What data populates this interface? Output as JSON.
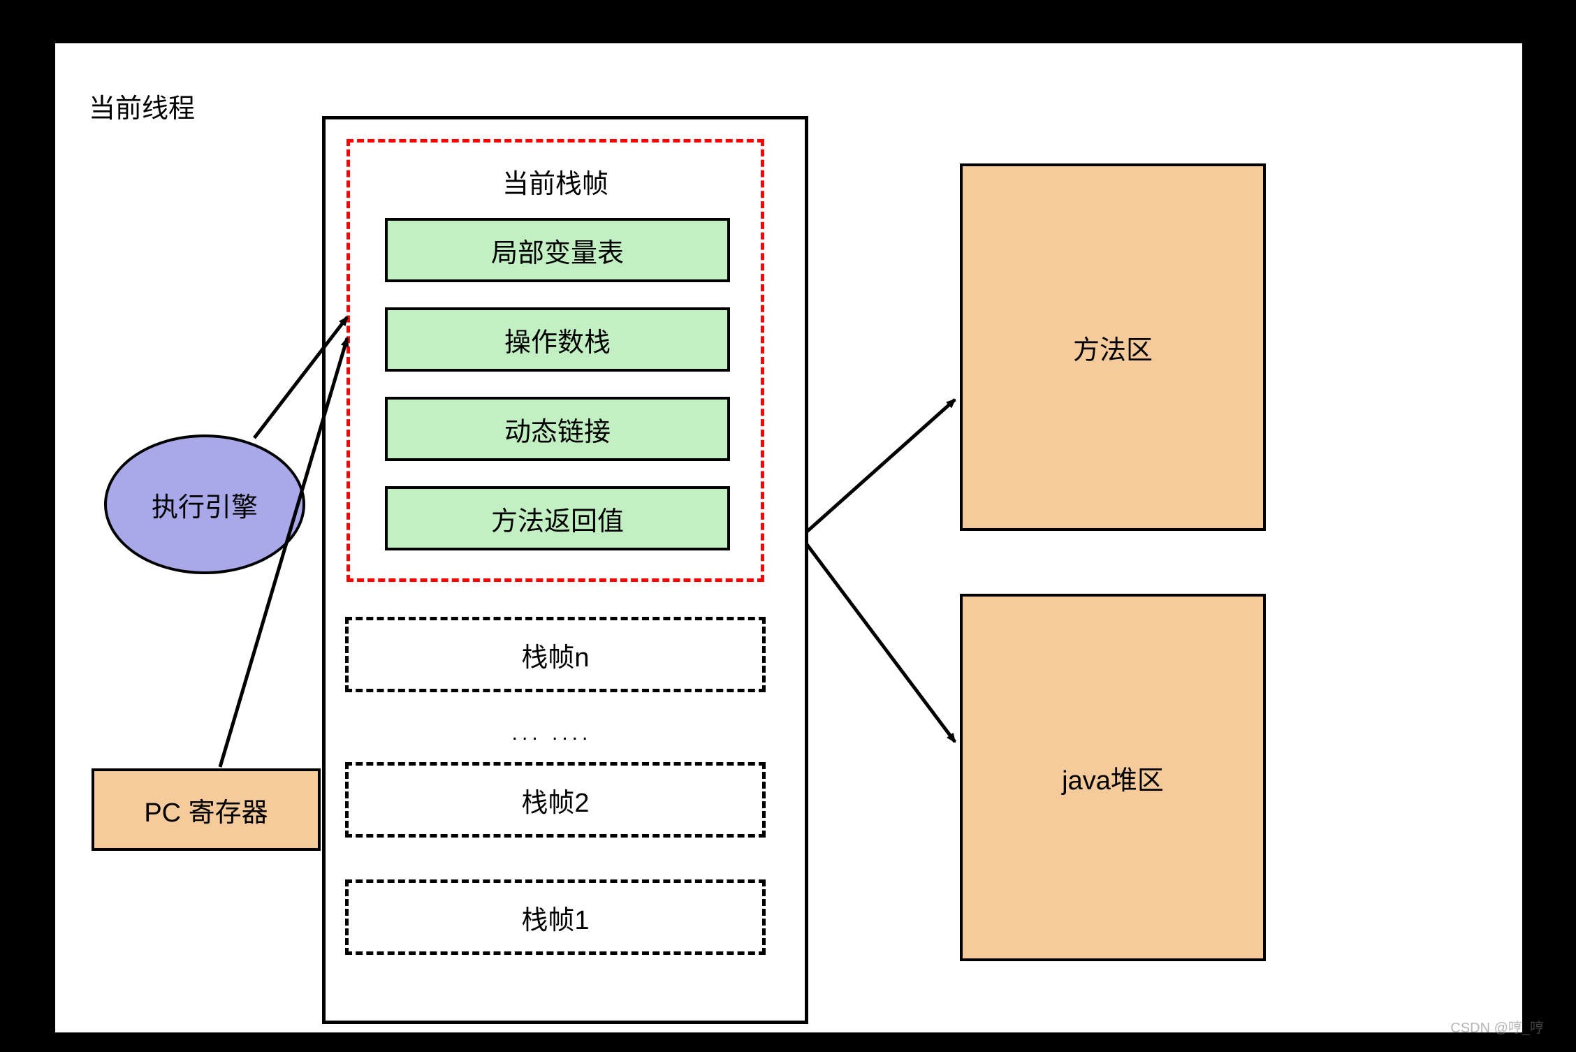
{
  "thread_title": "当前线程",
  "current_frame_title": "当前栈帧",
  "frame_slots": {
    "local_vars": "局部变量表",
    "operand_stack": "操作数栈",
    "dynamic_link": "动态链接",
    "return_value": "方法返回值"
  },
  "other_frames": {
    "frame_n": "栈帧n",
    "ellipsis": "...   ....",
    "frame_2": "栈帧2",
    "frame_1": "栈帧1"
  },
  "exec_engine": "执行引擎",
  "pc_register": "PC 寄存器",
  "method_area": "方法区",
  "heap_area": "java堆区",
  "watermark": "CSDN @哼_哼",
  "colors": {
    "frame_green": "#c2f0c2",
    "peach": "#f6cb9c",
    "purple": "#a9a8e8",
    "red_dashed": "#ff0000"
  }
}
